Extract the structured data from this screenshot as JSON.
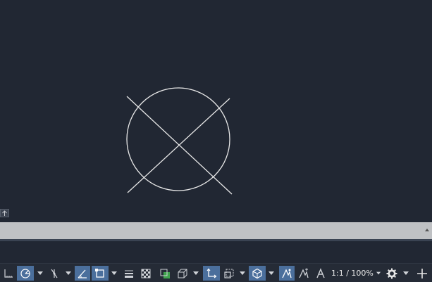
{
  "drawing": {
    "objects": [
      "circle",
      "line",
      "line"
    ]
  },
  "command_line": {
    "input_value": ""
  },
  "status_bar": {
    "tools": [
      {
        "icon": "grid-icon",
        "active": false
      },
      {
        "icon": "snap-mode-icon",
        "active": true
      },
      {
        "icon": "ortho-icon",
        "active": false
      },
      {
        "icon": "isodraft-icon",
        "active": true
      },
      {
        "icon": "osnap-icon",
        "active": true
      },
      {
        "icon": "lineweight-icon",
        "active": false
      },
      {
        "icon": "transparency-icon",
        "active": false
      },
      {
        "icon": "selection-cycling-icon",
        "active": false
      },
      {
        "icon": "3d-osnap-icon",
        "active": false
      },
      {
        "icon": "dynamic-ucs-icon",
        "active": true
      },
      {
        "icon": "selection-filter-icon",
        "active": false
      },
      {
        "icon": "gizmo-icon",
        "active": true
      },
      {
        "icon": "annotation-visibility-icon",
        "active": true
      },
      {
        "icon": "auto-scale-icon",
        "active": false
      },
      {
        "icon": "annotation-scale-icon",
        "active": false
      },
      {
        "icon": "workspace-gear-icon",
        "active": false
      },
      {
        "icon": "customize-plus-icon",
        "active": false
      }
    ],
    "annotation_scale": "1:1 / 100%"
  },
  "colors": {
    "canvas_bg": "#212733",
    "geometry": "#e8e8e8",
    "command_bar": "#bfc1c4",
    "active_button": "#4b6f9c"
  }
}
